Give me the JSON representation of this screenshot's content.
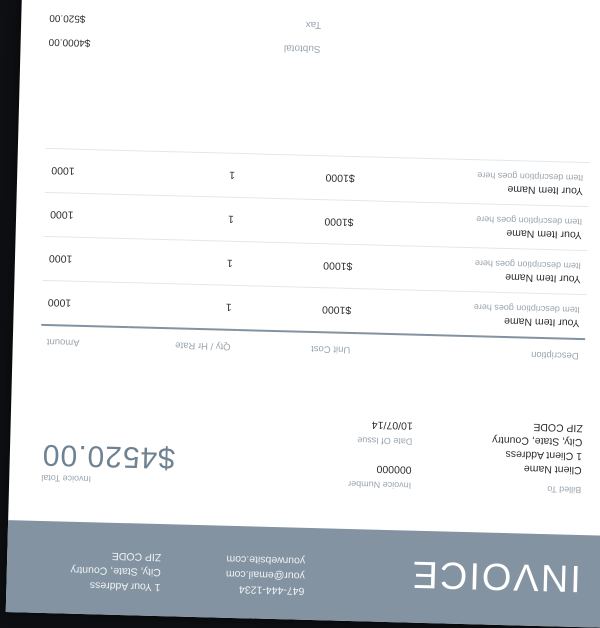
{
  "header": {
    "title": "INVOICE",
    "contact": [
      "647-444-1234",
      "your@email.com",
      "yourwebsite.com"
    ],
    "address": [
      "1 Your Address",
      "City, State, Country",
      "ZIP CODE"
    ]
  },
  "billed_to": {
    "label": "Billed To",
    "lines": [
      "Client Name",
      "1 Client Address",
      "City, State, Country",
      "ZIP CODE"
    ]
  },
  "invoice_meta": {
    "number_label": "Invoice Number",
    "number": "000000",
    "date_label": "Date Of Issue",
    "date": "10/07/14"
  },
  "invoice_total": {
    "label": "Invoice Total",
    "value": "$4520.00"
  },
  "table": {
    "headers": [
      "Description",
      "Unit Cost",
      "Qty / Hr Rate",
      "Amount"
    ],
    "rows": [
      {
        "name": "Your Item Name",
        "desc": "Item description goes here",
        "unit": "$1000",
        "qty": "1",
        "amount": "1000"
      },
      {
        "name": "Your Item Name",
        "desc": "Item description goes here",
        "unit": "$1000",
        "qty": "1",
        "amount": "1000"
      },
      {
        "name": "Your Item Name",
        "desc": "Item description goes here",
        "unit": "$1000",
        "qty": "1",
        "amount": "1000"
      },
      {
        "name": "Your Item Name",
        "desc": "Item description goes here",
        "unit": "$1000",
        "qty": "1",
        "amount": "1000"
      }
    ]
  },
  "summary": {
    "subtotal_label": "Subtotal",
    "subtotal": "$4000.00",
    "tax_label": "Tax",
    "tax": "$520.00"
  }
}
